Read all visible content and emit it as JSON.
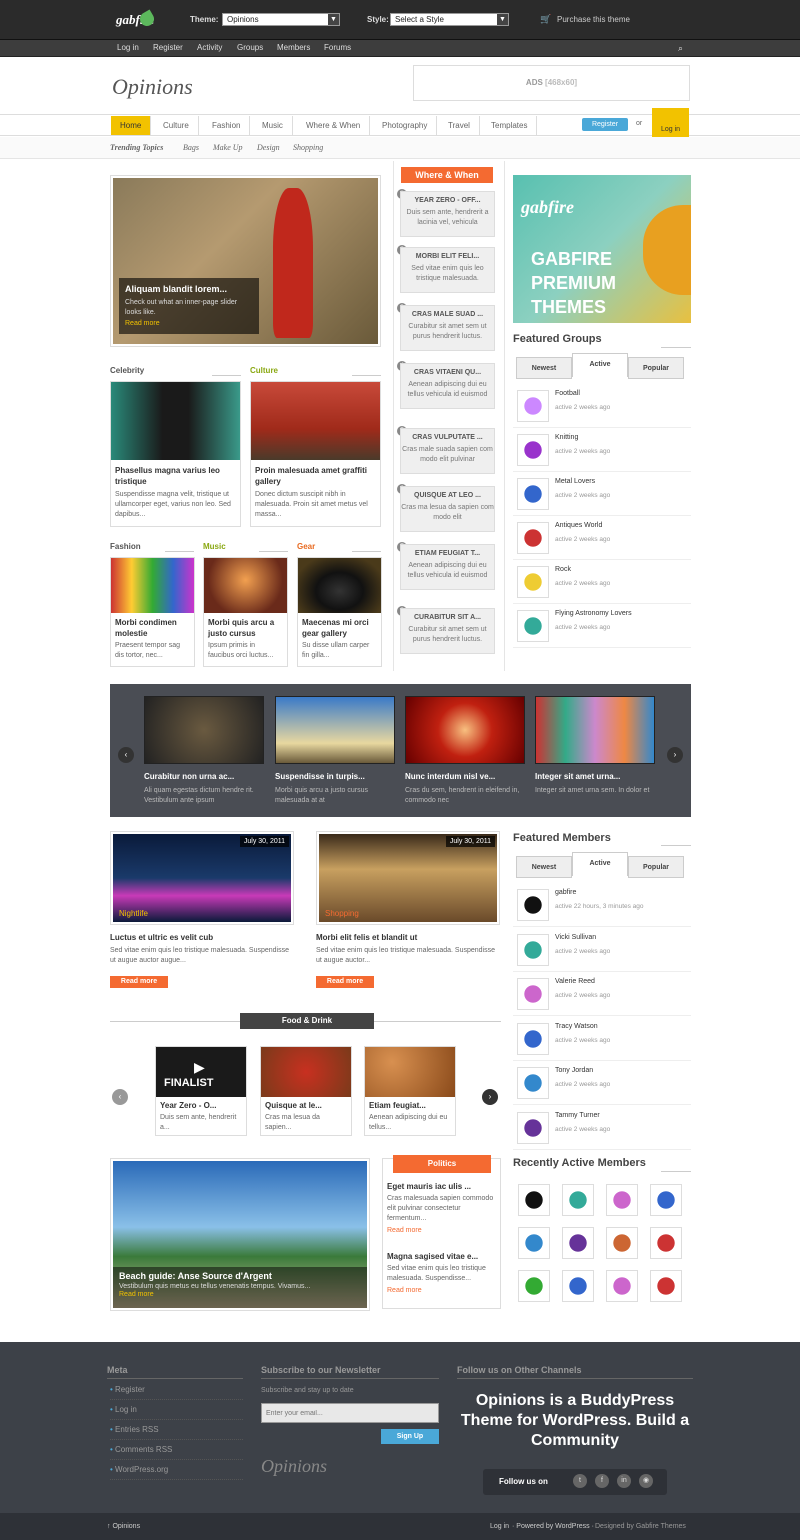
{
  "topbar": {
    "logo": "gabfire",
    "theme_label": "Theme:",
    "theme_value": "Opinions",
    "style_label": "Style:",
    "style_value": "Select a Style",
    "purchase": "Purchase this theme"
  },
  "navbar": [
    "Log in",
    "Register",
    "Activity",
    "Groups",
    "Members",
    "Forums"
  ],
  "header": {
    "brand": "Opinions",
    "ads_label": "ADS",
    "ads_size": "[468x60]"
  },
  "mainnav": [
    "Home",
    "Culture",
    "Fashion",
    "Music",
    "Where & When",
    "Photography",
    "Travel",
    "Templates"
  ],
  "register_btn": "Register",
  "or": "or",
  "login_flag": "Log in",
  "trending": [
    "Trending Topics",
    "Bags",
    "Make Up",
    "Design",
    "Shopping"
  ],
  "featured": {
    "title": "Aliquam blandit lorem...",
    "text": "Check out what an inner-page slider looks like.",
    "more": "Read more"
  },
  "cats_top": [
    {
      "cat": "Celebrity",
      "title": "Phasellus magna varius leo tristique",
      "text": "Suspendisse magna velit, tristique ut ullamcorper eget, varius non leo. Sed dapibus..."
    },
    {
      "cat": "Culture",
      "title": "Proin malesuada amet graffiti gallery",
      "text": "Donec dictum suscipit nibh in malesuada. Proin sit amet metus vel massa..."
    }
  ],
  "cats_bottom": [
    {
      "cat": "Fashion",
      "title": "Morbi condimen molestie",
      "text": "Praesent tempor sag dis tortor, nec..."
    },
    {
      "cat": "Music",
      "title": "Morbi quis arcu a justo cursus",
      "text": "Ipsum primis in faucibus orci luctus..."
    },
    {
      "cat": "Gear",
      "title": "Maecenas mi orci gear gallery",
      "text": "Su disse ullam carper fin gilla..."
    }
  ],
  "where_when": {
    "title": "Where & When",
    "items": [
      {
        "n": "1",
        "t": "YEAR ZERO - OFF...",
        "d": "Duis sem ante, hendrerit a lacinia vel, vehicula"
      },
      {
        "n": "2",
        "t": "MORBI ELIT FELI...",
        "d": "Sed vitae enim quis leo tristique malesuada."
      },
      {
        "n": "3",
        "t": "CRAS MALE SUAD ...",
        "d": "Curabitur sit amet sem ut purus hendrerit luctus."
      },
      {
        "n": "4",
        "t": "CRAS VITAENI QU...",
        "d": "Aenean adipiscing dui eu tellus vehicula id euismod"
      },
      {
        "n": "5",
        "t": "CRAS VULPUTATE ...",
        "d": "Cras male suada sapien com modo elit pulvinar"
      },
      {
        "n": "6",
        "t": "QUISQUE AT LEO ...",
        "d": "Cras ma lesua da sapien com modo elit"
      },
      {
        "n": "7",
        "t": "ETIAM FEUGIAT T...",
        "d": "Aenean adipiscing dui eu tellus vehicula id euismod"
      },
      {
        "n": "8",
        "t": "CURABITUR SIT A...",
        "d": "Curabitur sit amet sem ut purus hendrerit luctus."
      }
    ]
  },
  "promo": [
    "GABFIRE",
    "PREMIUM",
    "THEMES"
  ],
  "featured_groups": {
    "title": "Featured Groups",
    "tabs": [
      "Newest",
      "Active",
      "Popular"
    ],
    "items": [
      {
        "name": "Football",
        "time": "active 2 weeks ago"
      },
      {
        "name": "Knitting",
        "time": "active 2 weeks ago"
      },
      {
        "name": "Metal Lovers",
        "time": "active 2 weeks ago"
      },
      {
        "name": "Antiques World",
        "time": "active 2 weeks ago"
      },
      {
        "name": "Rock",
        "time": "active 2 weeks ago"
      },
      {
        "name": "Flying Astronomy Lovers",
        "time": "active 2 weeks ago"
      }
    ]
  },
  "slider": [
    {
      "t": "Curabitur non urna ac...",
      "d": "Ali quam egestas dictum hendre rit. Vestibulum ante ipsum"
    },
    {
      "t": "Suspendisse in turpis...",
      "d": "Morbi quis arcu a justo cursus malesuada at at"
    },
    {
      "t": "Nunc interdum nisl ve...",
      "d": "Cras du sem, hendrent in eleifend in, commodo nec"
    },
    {
      "t": "Integer sit amet urna...",
      "d": "Integer sit amet urna sem. In dolor et"
    }
  ],
  "posts": [
    {
      "date": "July 30, 2011",
      "tag": "Nightlife",
      "title": "Luctus et ultric es velit cub",
      "text": "Sed vitae enim quis leo tristique malesuada. Suspendisse ut augue auctor augue...",
      "more": "Read more"
    },
    {
      "date": "July 30, 2011",
      "tag": "Shopping",
      "title": "Morbi elit felis et blandit ut",
      "text": "Sed vitae enim quis leo tristique malesuada. Suspendisse ut augue auctor...",
      "more": "Read more"
    }
  ],
  "food": {
    "title": "Food & Drink",
    "items": [
      {
        "t": "Year Zero - O...",
        "d": "Duis sem ante, hendrerit a..."
      },
      {
        "t": "Quisque at le...",
        "d": "Cras ma lesua da sapien..."
      },
      {
        "t": "Etiam feugiat...",
        "d": "Aenean adipiscing dui eu tellus..."
      }
    ],
    "video_text": "FINALIST"
  },
  "beach": {
    "title": "Beach guide: Anse Source d'Argent",
    "text": "Vestibulum quis metus eu tellus venenatis tempus. Vivamus...",
    "more": "Read more"
  },
  "politics": {
    "title": "Politics",
    "items": [
      {
        "t": "Eget mauris iac ulis ...",
        "d": "Cras malesuada sapien commodo elit pulvinar consectetur fermentum...",
        "more": "Read more"
      },
      {
        "t": "Magna sagised vitae e...",
        "d": "Sed vitae enim quis leo tristique malesuada. Suspendisse...",
        "more": "Read more"
      }
    ]
  },
  "featured_members": {
    "title": "Featured Members",
    "tabs": [
      "Newest",
      "Active",
      "Popular"
    ],
    "items": [
      {
        "name": "gabfire",
        "time": "active 22 hours, 3 minutes ago"
      },
      {
        "name": "Vicki Sullivan",
        "time": "active 2 weeks ago"
      },
      {
        "name": "Valerie Reed",
        "time": "active 2 weeks ago"
      },
      {
        "name": "Tracy Watson",
        "time": "active 2 weeks ago"
      },
      {
        "name": "Tony Jordan",
        "time": "active 2 weeks ago"
      },
      {
        "name": "Tammy Turner",
        "time": "active 2 weeks ago"
      }
    ]
  },
  "recent_members_title": "Recently Active Members",
  "footer": {
    "meta_title": "Meta",
    "meta_links": [
      "Register",
      "Log in",
      "Entries RSS",
      "Comments RSS",
      "WordPress.org"
    ],
    "newsletter_title": "Subscribe to our Newsletter",
    "newsletter_text": "Subscribe and stay up to date",
    "email_placeholder": "Enter your email...",
    "signup": "Sign Up",
    "brand": "Opinions",
    "follow_title": "Follow us on Other Channels",
    "tagline": "Opinions is a BuddyPress Theme for WordPress. Build a Community",
    "follow_us": "Follow us on"
  },
  "bottombar": {
    "left": "↑ Opinions",
    "right_login": "Log in",
    "right_powered": "· Powered by WordPress ·",
    "right_designed": "Designed by Gabfire Themes"
  },
  "colors": {
    "accent": "#f2c200",
    "orange": "#f46a31",
    "blue": "#4aa8d8",
    "footer": "#3d4148"
  }
}
